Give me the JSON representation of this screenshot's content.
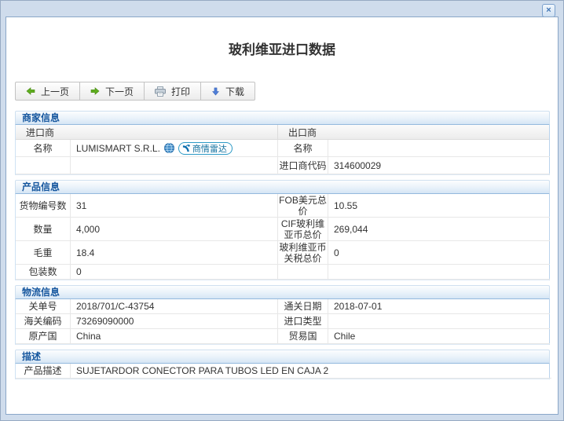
{
  "dialog": {
    "title": "玻利维亚进口数据",
    "close": "×"
  },
  "toolbar": {
    "prev_label": "上一页",
    "next_label": "下一页",
    "print_label": "打印",
    "download_label": "下载"
  },
  "merchant": {
    "header": "商家信息",
    "importer_col": "进口商",
    "exporter_col": "出口商",
    "name_label_left": "名称",
    "importer_name": "LUMISMART S.R.L.",
    "radar_badge": "商情雷达",
    "name_label_right": "名称",
    "exporter_name": "",
    "importer_code_label": "进口商代码",
    "importer_code": "314600029"
  },
  "product": {
    "header": "产品信息",
    "rows": [
      {
        "l1": "货物编号数",
        "v1": "31",
        "l2": "FOB美元总价",
        "v2": "10.55"
      },
      {
        "l1": "数量",
        "v1": "4,000",
        "l2": "CIF玻利维亚币总价",
        "v2": "269,044"
      },
      {
        "l1": "毛重",
        "v1": "18.4",
        "l2": "玻利维亚币关税总价",
        "v2": "0"
      },
      {
        "l1": "包装数",
        "v1": "0",
        "l2": "",
        "v2": ""
      }
    ]
  },
  "logistics": {
    "header": "物流信息",
    "rows": [
      {
        "l1": "关单号",
        "v1": "2018/701/C-43754",
        "l2": "通关日期",
        "v2": "2018-07-01"
      },
      {
        "l1": "海关编码",
        "v1": "73269090000",
        "l2": "进口类型",
        "v2": ""
      },
      {
        "l1": "原产国",
        "v1": "China",
        "l2": "贸易国",
        "v2": "Chile"
      }
    ]
  },
  "description": {
    "header": "描述",
    "label": "产品描述",
    "value": "SUJETARDOR CONECTOR PARA TUBOS LED EN CAJA 2"
  },
  "colors": {
    "section_title_blue": "#15569e",
    "frame_blue": "#8aa7c8",
    "badge_blue": "#2e9ac6",
    "arrow_green": "#5fae1f",
    "arrow_blue": "#4f7fd9"
  }
}
